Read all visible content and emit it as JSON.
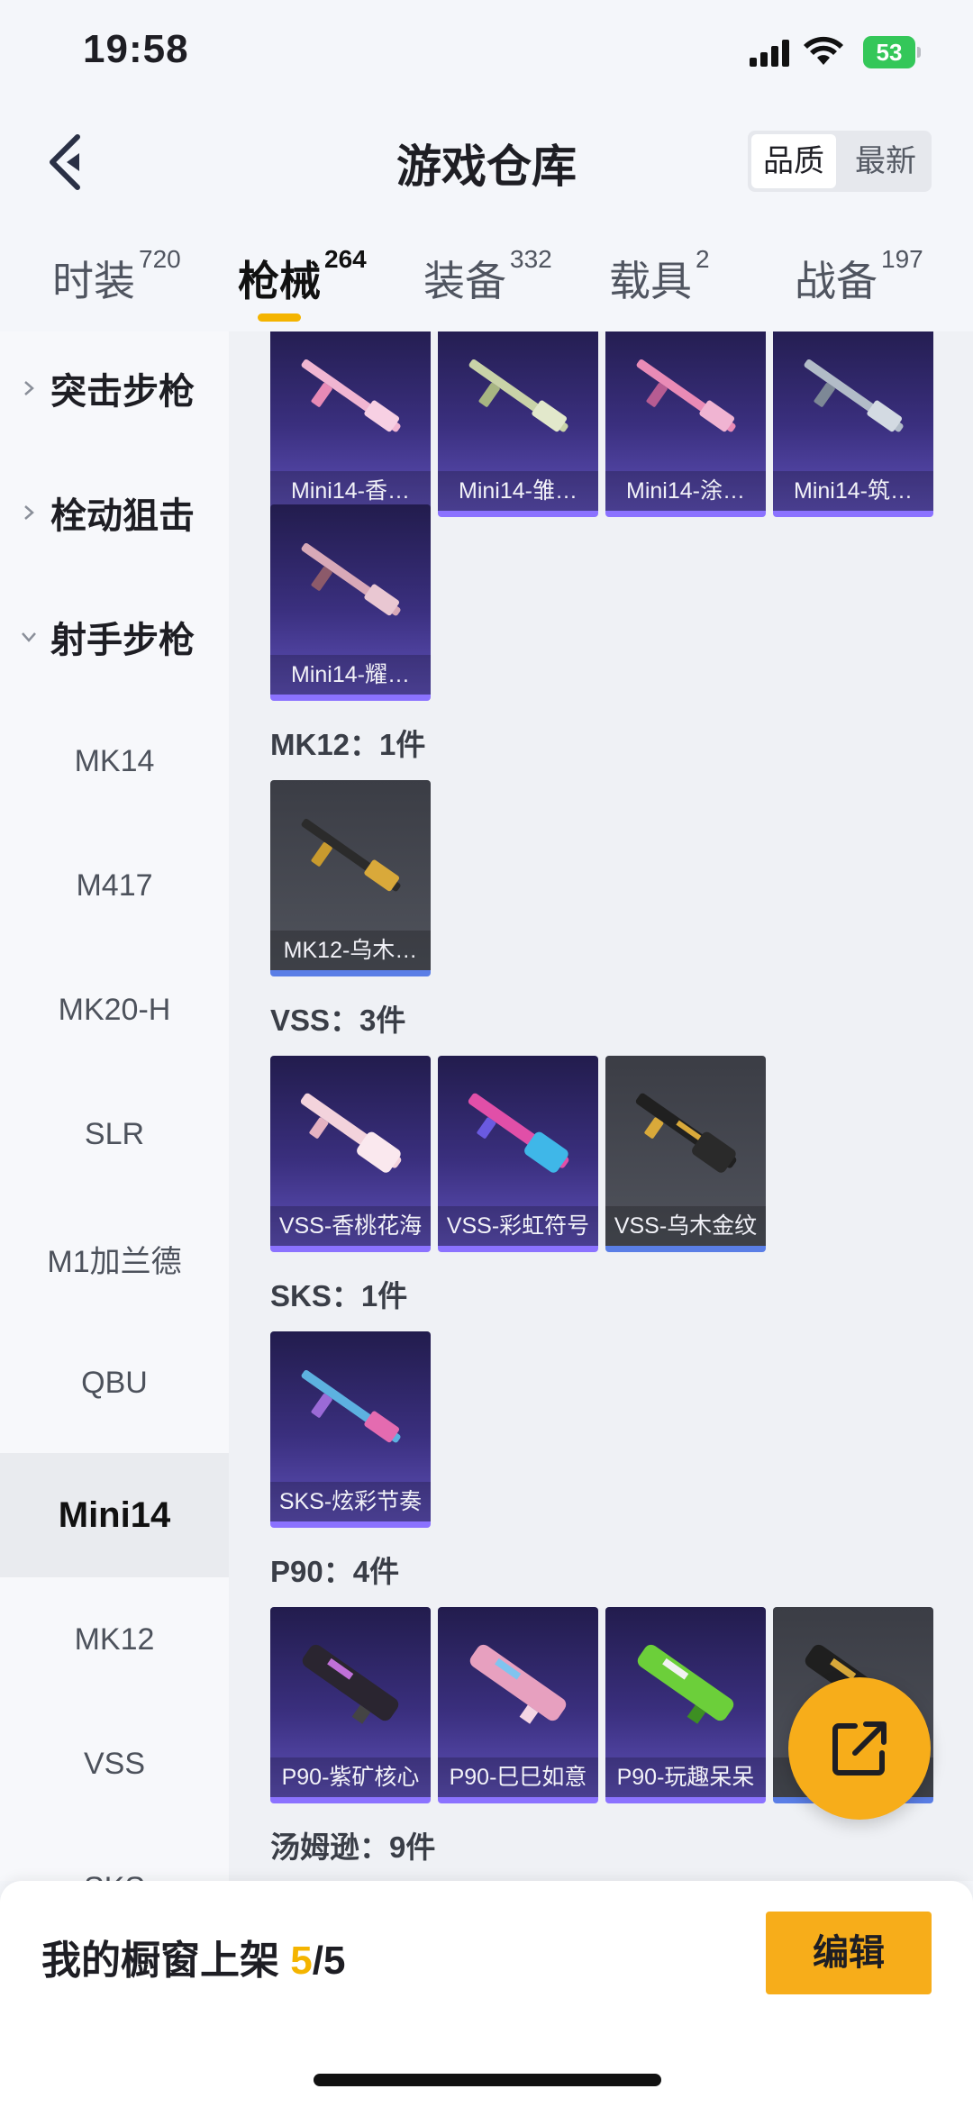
{
  "status_bar": {
    "time": "19:58",
    "battery": "53"
  },
  "header": {
    "title": "游戏仓库",
    "sort_options": [
      "品质",
      "最新"
    ],
    "active_sort": "品质"
  },
  "tabs": [
    {
      "label": "时装",
      "count": "720"
    },
    {
      "label": "枪械",
      "count": "264",
      "active": true
    },
    {
      "label": "装备",
      "count": "332"
    },
    {
      "label": "载具",
      "count": "2"
    },
    {
      "label": "战备",
      "count": "197"
    }
  ],
  "sidebar": {
    "groups": [
      {
        "label": "突击步枪",
        "expanded": false
      },
      {
        "label": "栓动狙击",
        "expanded": false
      },
      {
        "label": "射手步枪",
        "expanded": true
      }
    ],
    "items": [
      "MK14",
      "M417",
      "MK20-H",
      "SLR",
      "M1加兰德",
      "QBU",
      "Mini14",
      "MK12",
      "VSS",
      "SKS"
    ],
    "active_item": "Mini14"
  },
  "content": {
    "sections": [
      {
        "label": "",
        "items": [
          "Mini14-香…",
          "Mini14-雏…",
          "Mini14-涂…",
          "Mini14-筑…",
          "Mini14-耀…"
        ]
      },
      {
        "label": "MK12：1件",
        "items": [
          "MK12-乌木…"
        ]
      },
      {
        "label": "VSS：3件",
        "items": [
          "VSS-香桃花海",
          "VSS-彩虹符号",
          "VSS-乌木金纹"
        ]
      },
      {
        "label": "SKS：1件",
        "items": [
          "SKS-炫彩节奏"
        ]
      },
      {
        "label": "P90：4件",
        "items": [
          "P90-紫矿核心",
          "P90-巳巳如意",
          "P90-玩趣呆呆",
          "P"
        ]
      },
      {
        "label": "汤姆逊：9件",
        "items": []
      }
    ]
  },
  "bottom_bar": {
    "showcase_label": "我的橱窗上架",
    "showcase_current": "5",
    "showcase_total": "/5",
    "edit_label": "编辑"
  },
  "colors": {
    "accent": "#f7ad1a",
    "indicator": "#f4b400",
    "rare_border": "#8b72ff",
    "common_border": "#5a7ee6"
  },
  "icons": [
    "back-arrow-icon",
    "chevron-right-icon",
    "chevron-down-icon",
    "share-external-icon",
    "rifle-icon"
  ]
}
